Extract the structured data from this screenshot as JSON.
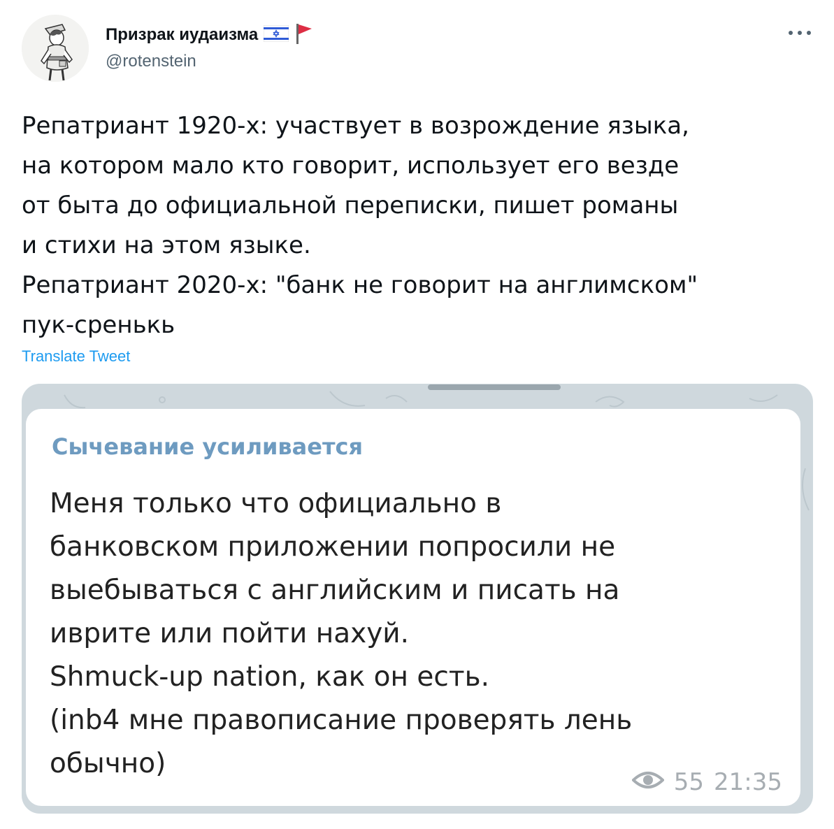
{
  "author": {
    "display_name": "Призрак иудаизма",
    "handle": "@rotenstein",
    "flags": [
      "israel-flag-icon",
      "red-flag-icon"
    ],
    "avatar_icon": "cartoon-soldier-avatar"
  },
  "tweet": {
    "text": "Репатриант 1920-х: участвует в возрождение языка,\nна котором мало кто говорит, использует его везде\nот быта до официальной переписки, пишет романы\nи стихи на этом языке.\nРепатриант 2020-х: \"банк не говорит на англимском\"\nпук-сренькь",
    "translate_label": "Translate Tweet",
    "more_icon": "more-options-icon"
  },
  "media": {
    "channel_name": "Сычевание усиливается",
    "message_text": "Меня только что официально в\nбанковском приложении попросили не\nвыебываться с английским и писать на\nиврите или пойти нахуй.\nShmuck-up nation, как он есть.\n(inb4 мне правописание проверять лень\nобычно)",
    "views": "55",
    "time": "21:35",
    "views_icon": "eye-icon"
  },
  "colors": {
    "link": "#1d9bf0",
    "channel_name": "#6e9bc0",
    "meta_gray": "#a7adb2",
    "chat_background": "#cfd8dd"
  }
}
